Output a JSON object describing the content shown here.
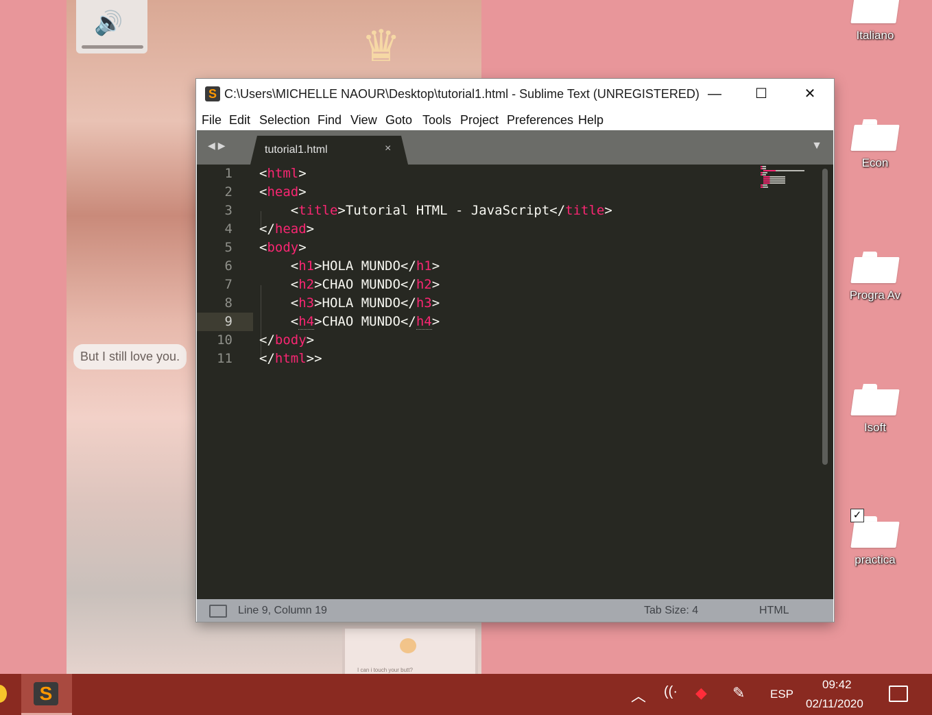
{
  "wallpaper": {
    "caption": "But I still love you.",
    "card_text": "I can i touch your butt?"
  },
  "desktop_icons": [
    {
      "label": "Italiano"
    },
    {
      "label": "Econ"
    },
    {
      "label": "Progra Av"
    },
    {
      "label": "Isoft"
    },
    {
      "label": "practica"
    }
  ],
  "window": {
    "title": "C:\\Users\\MICHELLE NAOUR\\Desktop\\tutorial1.html - Sublime Text (UNREGISTERED)",
    "app_icon_letter": "S",
    "controls": {
      "minimize": "—",
      "maximize": "☐",
      "close": "✕"
    },
    "menu": [
      "File",
      "Edit",
      "Selection",
      "Find",
      "View",
      "Goto",
      "Tools",
      "Project",
      "Preferences",
      "Help"
    ],
    "tab": {
      "name": "tutorial1.html",
      "close": "×",
      "nav_arrows": "◀▶",
      "dropdown": "▼"
    }
  },
  "editor": {
    "line_numbers": [
      "1",
      "2",
      "3",
      "4",
      "5",
      "6",
      "7",
      "8",
      "9",
      "10",
      "11"
    ],
    "active_line": 9,
    "lines": [
      [
        [
          "p",
          "<"
        ],
        [
          "t",
          "html"
        ],
        [
          "p",
          ">"
        ]
      ],
      [
        [
          "p",
          "<"
        ],
        [
          "t",
          "head"
        ],
        [
          "p",
          ">"
        ]
      ],
      [
        [
          "p",
          "    <"
        ],
        [
          "t",
          "title"
        ],
        [
          "p",
          ">Tutorial HTML - JavaScript</"
        ],
        [
          "t",
          "title"
        ],
        [
          "p",
          ">"
        ]
      ],
      [
        [
          "p",
          "</"
        ],
        [
          "t",
          "head"
        ],
        [
          "p",
          ">"
        ]
      ],
      [
        [
          "p",
          "<"
        ],
        [
          "t",
          "body"
        ],
        [
          "p",
          ">"
        ]
      ],
      [
        [
          "p",
          "    <"
        ],
        [
          "t",
          "h1"
        ],
        [
          "p",
          ">HOLA MUNDO</"
        ],
        [
          "t",
          "h1"
        ],
        [
          "p",
          ">"
        ]
      ],
      [
        [
          "p",
          "    <"
        ],
        [
          "t",
          "h2"
        ],
        [
          "p",
          ">CHAO MUNDO</"
        ],
        [
          "t",
          "h2"
        ],
        [
          "p",
          ">"
        ]
      ],
      [
        [
          "p",
          "    <"
        ],
        [
          "t",
          "h3"
        ],
        [
          "p",
          ">HOLA MUNDO</"
        ],
        [
          "t",
          "h3"
        ],
        [
          "p",
          ">"
        ]
      ],
      [
        [
          "p",
          "    <"
        ],
        [
          "t",
          "h4"
        ],
        [
          "p",
          ">CHAO MUNDO</"
        ],
        [
          "t",
          "h4"
        ],
        [
          "p",
          ">"
        ]
      ],
      [
        [
          "p",
          "</"
        ],
        [
          "t",
          "body"
        ],
        [
          "p",
          ">"
        ]
      ],
      [
        [
          "p",
          "</"
        ],
        [
          "t",
          "html"
        ],
        [
          "p",
          ">>"
        ]
      ]
    ]
  },
  "statusbar": {
    "position": "Line 9, Column 19",
    "tab_size": "Tab Size: 4",
    "syntax": "HTML"
  },
  "taskbar": {
    "language": "ESP",
    "time": "09:42",
    "date": "02/11/2020",
    "chevron": "︿"
  },
  "colors": {
    "desktop_bg": "#e8969a",
    "editor_bg": "#272822",
    "tag_color": "#f92672",
    "text_color": "#f8f8f2",
    "taskbar_bg": "#8a2a21"
  }
}
